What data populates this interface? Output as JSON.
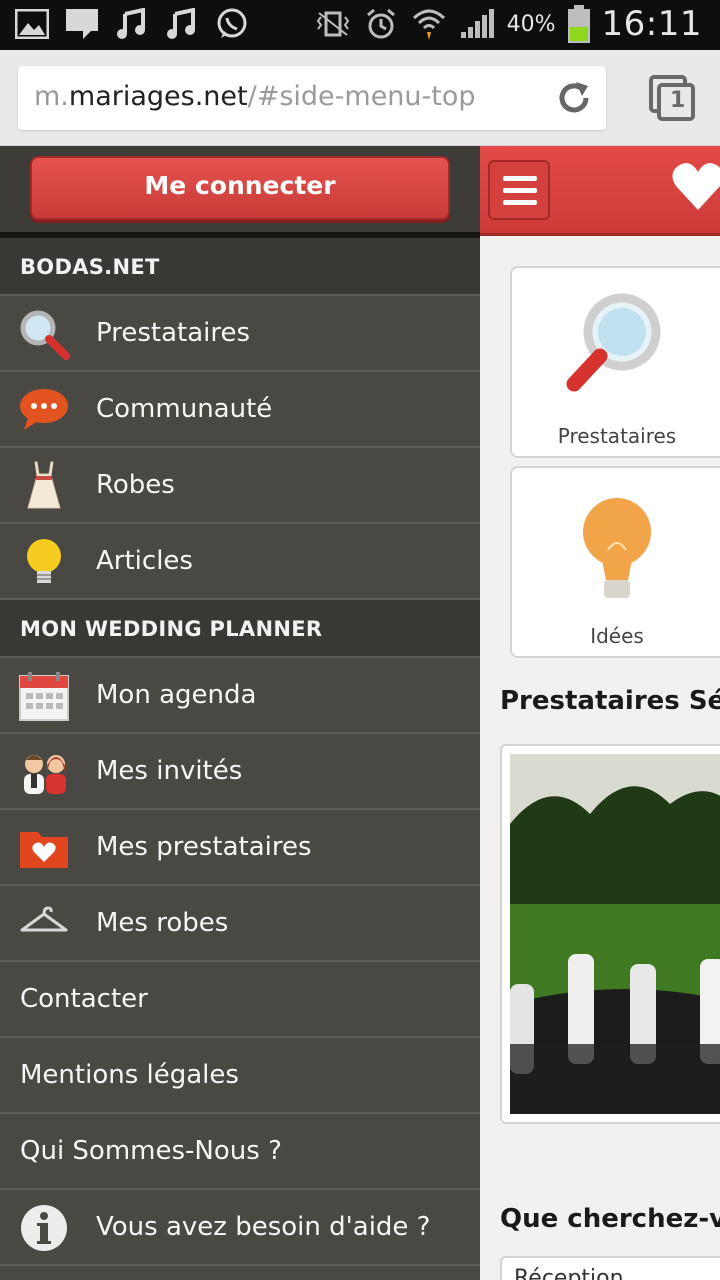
{
  "status_bar": {
    "battery_percent": "40%",
    "time": "16:11",
    "icons_left": [
      "gallery-icon",
      "message-icon",
      "music-icon",
      "music-icon",
      "whatsapp-icon"
    ],
    "icons_right": [
      "vibrate-icon",
      "alarm-icon",
      "wifi-icon",
      "signal-icon",
      "battery-icon"
    ]
  },
  "browser": {
    "url_prefix": "m.",
    "url_host": "mariages.net",
    "url_path": "/#side-menu-top",
    "tab_count": "1"
  },
  "side_menu": {
    "login_label": "Me connecter",
    "sections": [
      {
        "title": "BODAS.NET",
        "items": [
          {
            "label": "Prestataires",
            "icon": "magnifier-icon"
          },
          {
            "label": "Communauté",
            "icon": "speech-bubble-icon"
          },
          {
            "label": "Robes",
            "icon": "dress-icon"
          },
          {
            "label": "Articles",
            "icon": "lightbulb-icon"
          }
        ]
      },
      {
        "title": "MON WEDDING PLANNER",
        "items": [
          {
            "label": "Mon agenda",
            "icon": "calendar-icon"
          },
          {
            "label": "Mes invités",
            "icon": "guests-icon"
          },
          {
            "label": "Mes prestataires",
            "icon": "heart-folder-icon"
          },
          {
            "label": "Mes robes",
            "icon": "hanger-icon"
          }
        ]
      }
    ],
    "plain_items": [
      {
        "label": "Contacter"
      },
      {
        "label": "Mentions légales"
      },
      {
        "label": "Qui Sommes-Nous ?"
      }
    ],
    "help_item": {
      "label": "Vous avez besoin d'aide ?",
      "icon": "info-icon"
    }
  },
  "main": {
    "tiles": [
      {
        "label": "Prestataires",
        "icon": "magnifier-icon"
      },
      {
        "label": "Idées",
        "icon": "lightbulb-icon"
      }
    ],
    "featured_title": "Prestataires Séle",
    "search_title": "Que cherchez-vo",
    "select_value": "Réception"
  },
  "colors": {
    "brand_red": "#d9423f",
    "menu_bg": "#4a4843",
    "section_bg": "#3a3834"
  }
}
